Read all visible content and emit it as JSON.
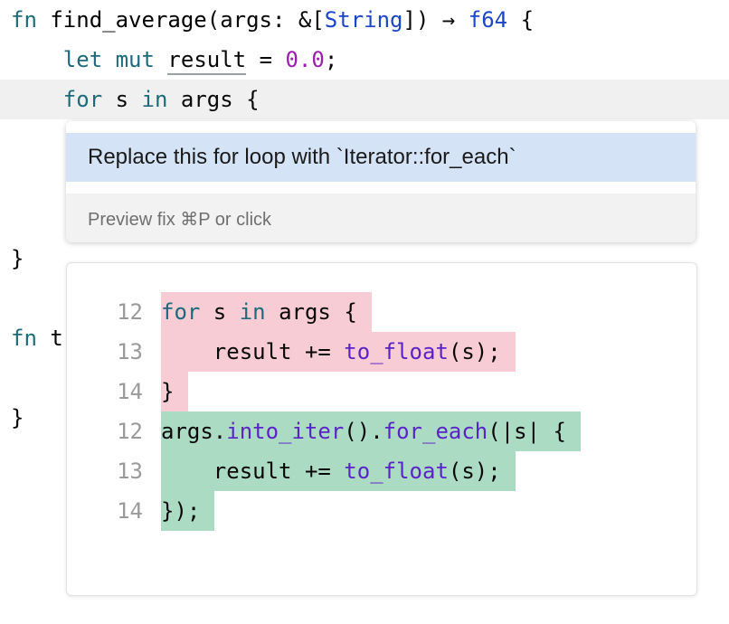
{
  "editor": {
    "line1": {
      "kw_fn": "fn",
      "name": "find_average",
      "params_open": "(args: &[",
      "type_string": "String",
      "params_close": "])",
      "arrow": "→",
      "ret_type": "f64",
      "brace": "{"
    },
    "line2": {
      "kw_let": "let",
      "kw_mut": "mut",
      "var": "result",
      "eq": "=",
      "num": "0.0",
      "semi": ";"
    },
    "line3": {
      "kw_for": "for",
      "var": "s",
      "kw_in": "in",
      "rest": "args {"
    },
    "line_close1": "}",
    "line_fn2": {
      "kw_fn": "fn",
      "name_start": "t"
    },
    "line_close2": "}"
  },
  "intention_popup": {
    "item_label": "Replace this for loop with `Iterator::for_each`",
    "hint": "Preview fix ⌘P or click"
  },
  "preview": {
    "removed": [
      {
        "num": "12",
        "parts": [
          {
            "t": "for",
            "c": "kw2"
          },
          {
            "t": " s ",
            "c": ""
          },
          {
            "t": "in",
            "c": "kw2"
          },
          {
            "t": " args {",
            "c": ""
          }
        ]
      },
      {
        "num": "13",
        "parts": [
          {
            "t": "    result += ",
            "c": ""
          },
          {
            "t": "to_float",
            "c": "fnc"
          },
          {
            "t": "(s);",
            "c": ""
          }
        ]
      },
      {
        "num": "14",
        "parts": [
          {
            "t": "}",
            "c": ""
          }
        ]
      }
    ],
    "added": [
      {
        "num": "12",
        "parts": [
          {
            "t": "args.",
            "c": ""
          },
          {
            "t": "into_iter",
            "c": "fnc"
          },
          {
            "t": "().",
            "c": ""
          },
          {
            "t": "for_each",
            "c": "fnc"
          },
          {
            "t": "(|s| {",
            "c": ""
          }
        ]
      },
      {
        "num": "13",
        "parts": [
          {
            "t": "    result += ",
            "c": ""
          },
          {
            "t": "to_float",
            "c": "fnc"
          },
          {
            "t": "(s);",
            "c": ""
          }
        ]
      },
      {
        "num": "14",
        "parts": [
          {
            "t": "});",
            "c": ""
          }
        ]
      }
    ]
  },
  "colors": {
    "removed_bg": "#f8ccd4",
    "added_bg": "#acdbc4",
    "selection_bg": "#d5e3f6",
    "current_line_bg": "#f0f0f0"
  }
}
